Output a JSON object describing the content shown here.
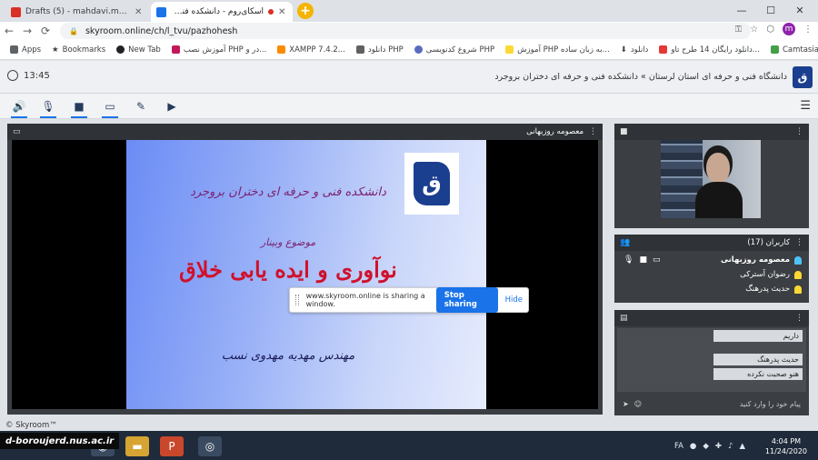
{
  "browser": {
    "tabs": [
      {
        "title": "Drafts (5) - mahdavi.mahdie88@...",
        "favicon_color": "#d93025",
        "active": false
      },
      {
        "title": "اسکای‌روم - دانشکده فنی و حرفه ای ...",
        "favicon_color": "#1a73e8",
        "active": true
      }
    ],
    "new_tab": "+",
    "window_controls": {
      "minimize": "—",
      "maximize": "☐",
      "close": "✕"
    },
    "url": "skyroom.online/ch/l_tvu/pazhohesh",
    "profile_initial": "m"
  },
  "bookmarks": [
    {
      "label": "Apps",
      "color": "#5f6368"
    },
    {
      "label": "Bookmarks",
      "color": "#5f6368"
    },
    {
      "label": "New Tab",
      "color": "#202124"
    },
    {
      "label": "آموزش نصب PHP در و...",
      "color": "#c2185b"
    },
    {
      "label": "XAMPP 7.4.2...",
      "color": "#fb8c00"
    },
    {
      "label": "دانلود PHP",
      "color": "#616161"
    },
    {
      "label": "شروع کدنویسی PHP",
      "color": "#5c6bc0"
    },
    {
      "label": "آموزش PHP به زبان ساده...",
      "color": "#fdd835"
    },
    {
      "label": "دانلود",
      "color": "#424242"
    },
    {
      "label": "دانلود رایگان 14 طرح تاو...",
      "color": "#e53935"
    },
    {
      "label": "Camtasia Studio 20...",
      "color": "#43a047"
    }
  ],
  "skyroom": {
    "time": "13:45",
    "room_title": "دانشگاه فنی و حرفه ای استان لرستان » دانشکده فنی و حرفه ای دختران بروجرد",
    "toolbar": [
      "speaker-icon",
      "microphone-icon",
      "camera-icon",
      "screen-share-icon",
      "whiteboard-icon",
      "play-icon"
    ],
    "stage": {
      "presenter": "معصومه روزبهانی",
      "slide": {
        "line1": "دانشکده فنی و حرفه ای دختران بروجرد",
        "line2": "موضوع وبینار",
        "headline": "نوآوری و ایده یابی خلاق",
        "author": "مهندس مهدیه مهدوی نسب"
      }
    },
    "users": {
      "header": "کاربران (17)",
      "list": [
        {
          "name": "معصومه روزبهانی",
          "bold": true,
          "icon_color": "#4fc3f7"
        },
        {
          "name": "رضوان آسترکی",
          "bold": false,
          "icon_color": "#fdd835"
        },
        {
          "name": "حدیث پدرهنگ",
          "bold": false,
          "icon_color": "#fdd835"
        }
      ]
    },
    "chat": {
      "messages": [
        "داریم",
        "حدیث پدرهنگ",
        "هنو صحبت نکرده"
      ],
      "placeholder": "پیام خود را وارد کنید"
    },
    "footer": "© Skyroom™"
  },
  "share_bar": {
    "text": "www.skyroom.online is sharing a window.",
    "stop": "Stop sharing",
    "hide": "Hide"
  },
  "taskbar": {
    "brand": "d-boroujerd.nus.ac.ir",
    "lang": "FA",
    "time": "4:04 PM",
    "date": "11/24/2020"
  }
}
